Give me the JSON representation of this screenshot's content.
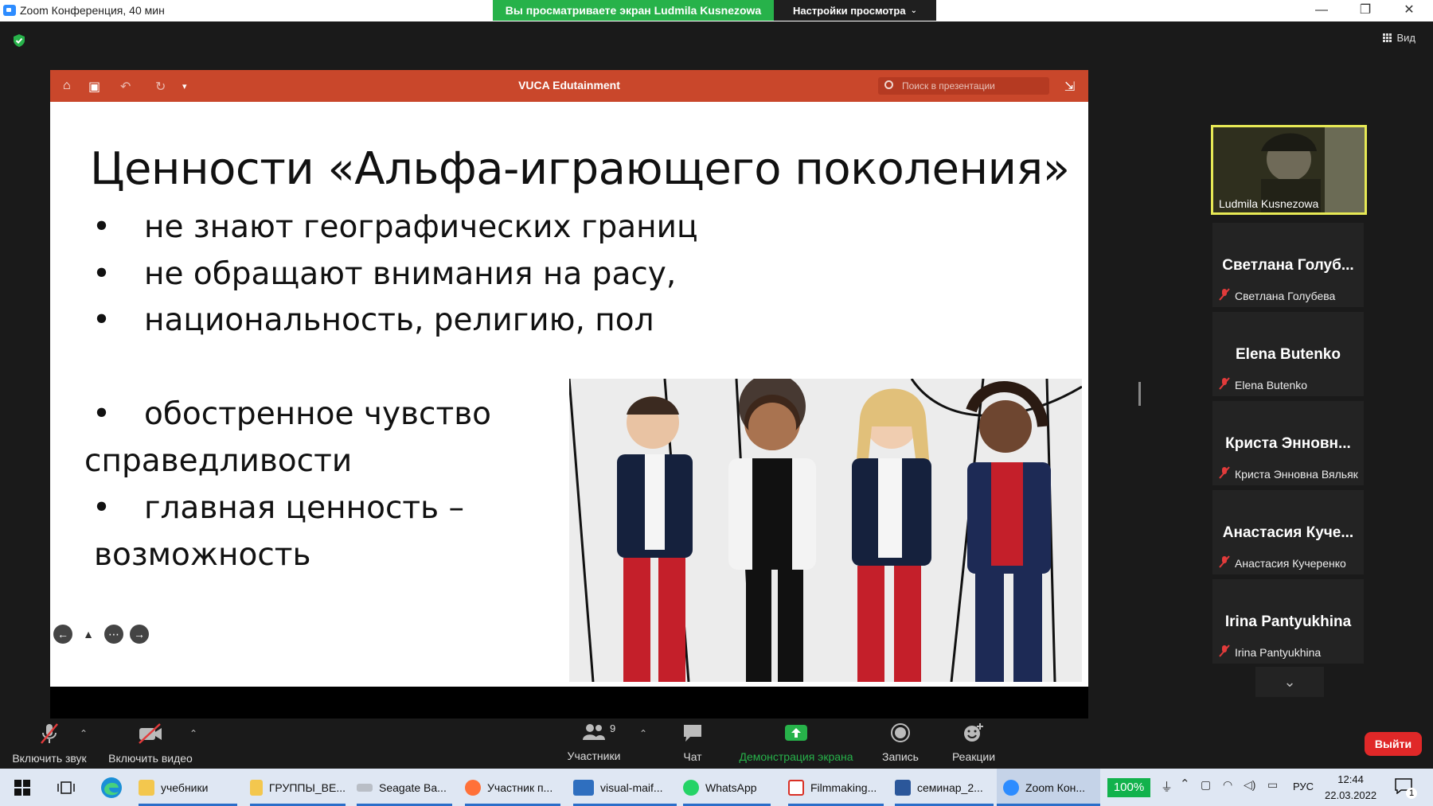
{
  "titlebar": {
    "title": "Zoom Конференция, 40 мин",
    "share_banner": "Вы просматриваете экран Ludmila Kusnezowa",
    "view_settings": "Настройки просмотра"
  },
  "view_button": "Вид",
  "presentation": {
    "app_title": "VUCA Edutainment",
    "search_placeholder": "Поиск в презентации",
    "slide": {
      "title": "Ценности «Альфа-играющего поколения»",
      "bullets": [
        "не знают географических границ",
        "не обращают внимания на расу,",
        "национальность, религию, пол"
      ],
      "bullet_4_line1": "обостренное чувство",
      "bullet_4_line2": "справедливости",
      "bullet_5_line1": "главная ценность –",
      "bullet_5_line2": "возможность"
    }
  },
  "participants": {
    "active_speaker": "Ludmila Kusnezowa",
    "tiles": [
      {
        "big": "Светлана Голуб...",
        "small": "Светлана Голубева"
      },
      {
        "big": "Elena Butenko",
        "small": "Elena Butenko"
      },
      {
        "big": "Криста Энновн...",
        "small": "Криста Энновна Вяльяк"
      },
      {
        "big": "Анастасия Куче...",
        "small": "Анастасия Кучеренко"
      },
      {
        "big": "Irina Pantyukhina",
        "small": "Irina Pantyukhina"
      }
    ]
  },
  "toolbar": {
    "unmute": "Включить звук",
    "start_video": "Включить видео",
    "participants": "Участники",
    "participants_count": "9",
    "chat": "Чат",
    "share_screen": "Демонстрация экрана",
    "record": "Запись",
    "reactions": "Реакции",
    "leave": "Выйти"
  },
  "taskbar": {
    "items": [
      {
        "label": "учебники"
      },
      {
        "label": "ГРУППЫ_ВЕ..."
      },
      {
        "label": "Seagate Ba..."
      },
      {
        "label": "Участник п..."
      },
      {
        "label": "visual-maif..."
      },
      {
        "label": "WhatsApp"
      },
      {
        "label": "Filmmaking..."
      },
      {
        "label": "семинар_2..."
      },
      {
        "label": "Zoom Кон..."
      }
    ],
    "battery": "100%",
    "language": "РУС",
    "time": "12:44",
    "date": "22.03.2022",
    "notification_count": "1"
  },
  "colors": {
    "ppt_red": "#c9472b",
    "share_green": "#27b24a",
    "leave_red": "#e02828",
    "speaker_border": "#e7e955"
  }
}
